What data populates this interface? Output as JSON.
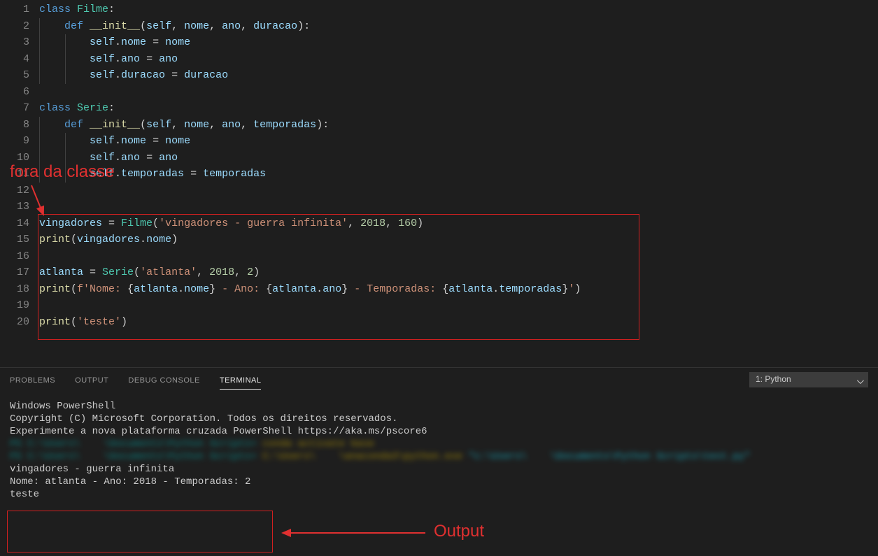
{
  "lineCount": 20,
  "annotations": {
    "foraDaClasse": "fora da classe",
    "output": "Output"
  },
  "code": {
    "l1": {
      "kw": "class",
      "cls": "Filme",
      "c": ":"
    },
    "l2": {
      "kw": "def",
      "fn": "__init__",
      "p1": "self",
      "p2": "nome",
      "p3": "ano",
      "p4": "duracao"
    },
    "l3": {
      "a": "self",
      "b": "nome",
      "c": "nome"
    },
    "l4": {
      "a": "self",
      "b": "ano",
      "c": "ano"
    },
    "l5": {
      "a": "self",
      "b": "duracao",
      "c": "duracao"
    },
    "l7": {
      "kw": "class",
      "cls": "Serie",
      "c": ":"
    },
    "l8": {
      "kw": "def",
      "fn": "__init__",
      "p1": "self",
      "p2": "nome",
      "p3": "ano",
      "p4": "temporadas"
    },
    "l9": {
      "a": "self",
      "b": "nome",
      "c": "nome"
    },
    "l10": {
      "a": "self",
      "b": "ano",
      "c": "ano"
    },
    "l11": {
      "a": "self",
      "b": "temporadas",
      "c": "temporadas"
    },
    "l14": {
      "v": "vingadores",
      "cls": "Filme",
      "s": "'vingadores - guerra infinita'",
      "n1": "2018",
      "n2": "160"
    },
    "l15": {
      "fn": "print",
      "v": "vingadores",
      "attr": "nome"
    },
    "l17": {
      "v": "atlanta",
      "cls": "Serie",
      "s": "'atlanta'",
      "n1": "2018",
      "n2": "2"
    },
    "l18": {
      "fn": "print",
      "prefix": "f'Nome: ",
      "v1": "atlanta",
      "a1": "nome",
      "mid1": " - Ano: ",
      "v2": "atlanta",
      "a2": "ano",
      "mid2": " - Temporadas: ",
      "v3": "atlanta",
      "a3": "temporadas",
      "suffix": "'"
    },
    "l20": {
      "fn": "print",
      "s": "'teste'"
    }
  },
  "panel": {
    "tabs": {
      "problems": "PROBLEMS",
      "output": "OUTPUT",
      "debug": "DEBUG CONSOLE",
      "terminal": "TERMINAL"
    },
    "selector": "1: Python"
  },
  "terminal": {
    "l1": "Windows PowerShell",
    "l2": "Copyright (C) Microsoft Corporation. Todos os direitos reservados.",
    "l3": "",
    "l4": "Experimente a nova plataforma cruzada PowerShell https://aka.ms/pscore6",
    "l5": "",
    "blur1a": "PS C:\\Users\\    \\Documents\\Python Scripts>",
    "blur1b": " conda activate base",
    "blur2a": "PS C:\\Users\\    \\Documents\\Python Scripts>",
    "blur2b": " C:\\Users\\    \\anaconda3\\python.exe ",
    "blur2c": "\"c:\\Users\\    \\Documents\\Python Scripts\\test.py\"",
    "out1": "vingadores - guerra infinita",
    "out2": "Nome: atlanta - Ano: 2018 - Temporadas: 2",
    "out3": "teste"
  }
}
